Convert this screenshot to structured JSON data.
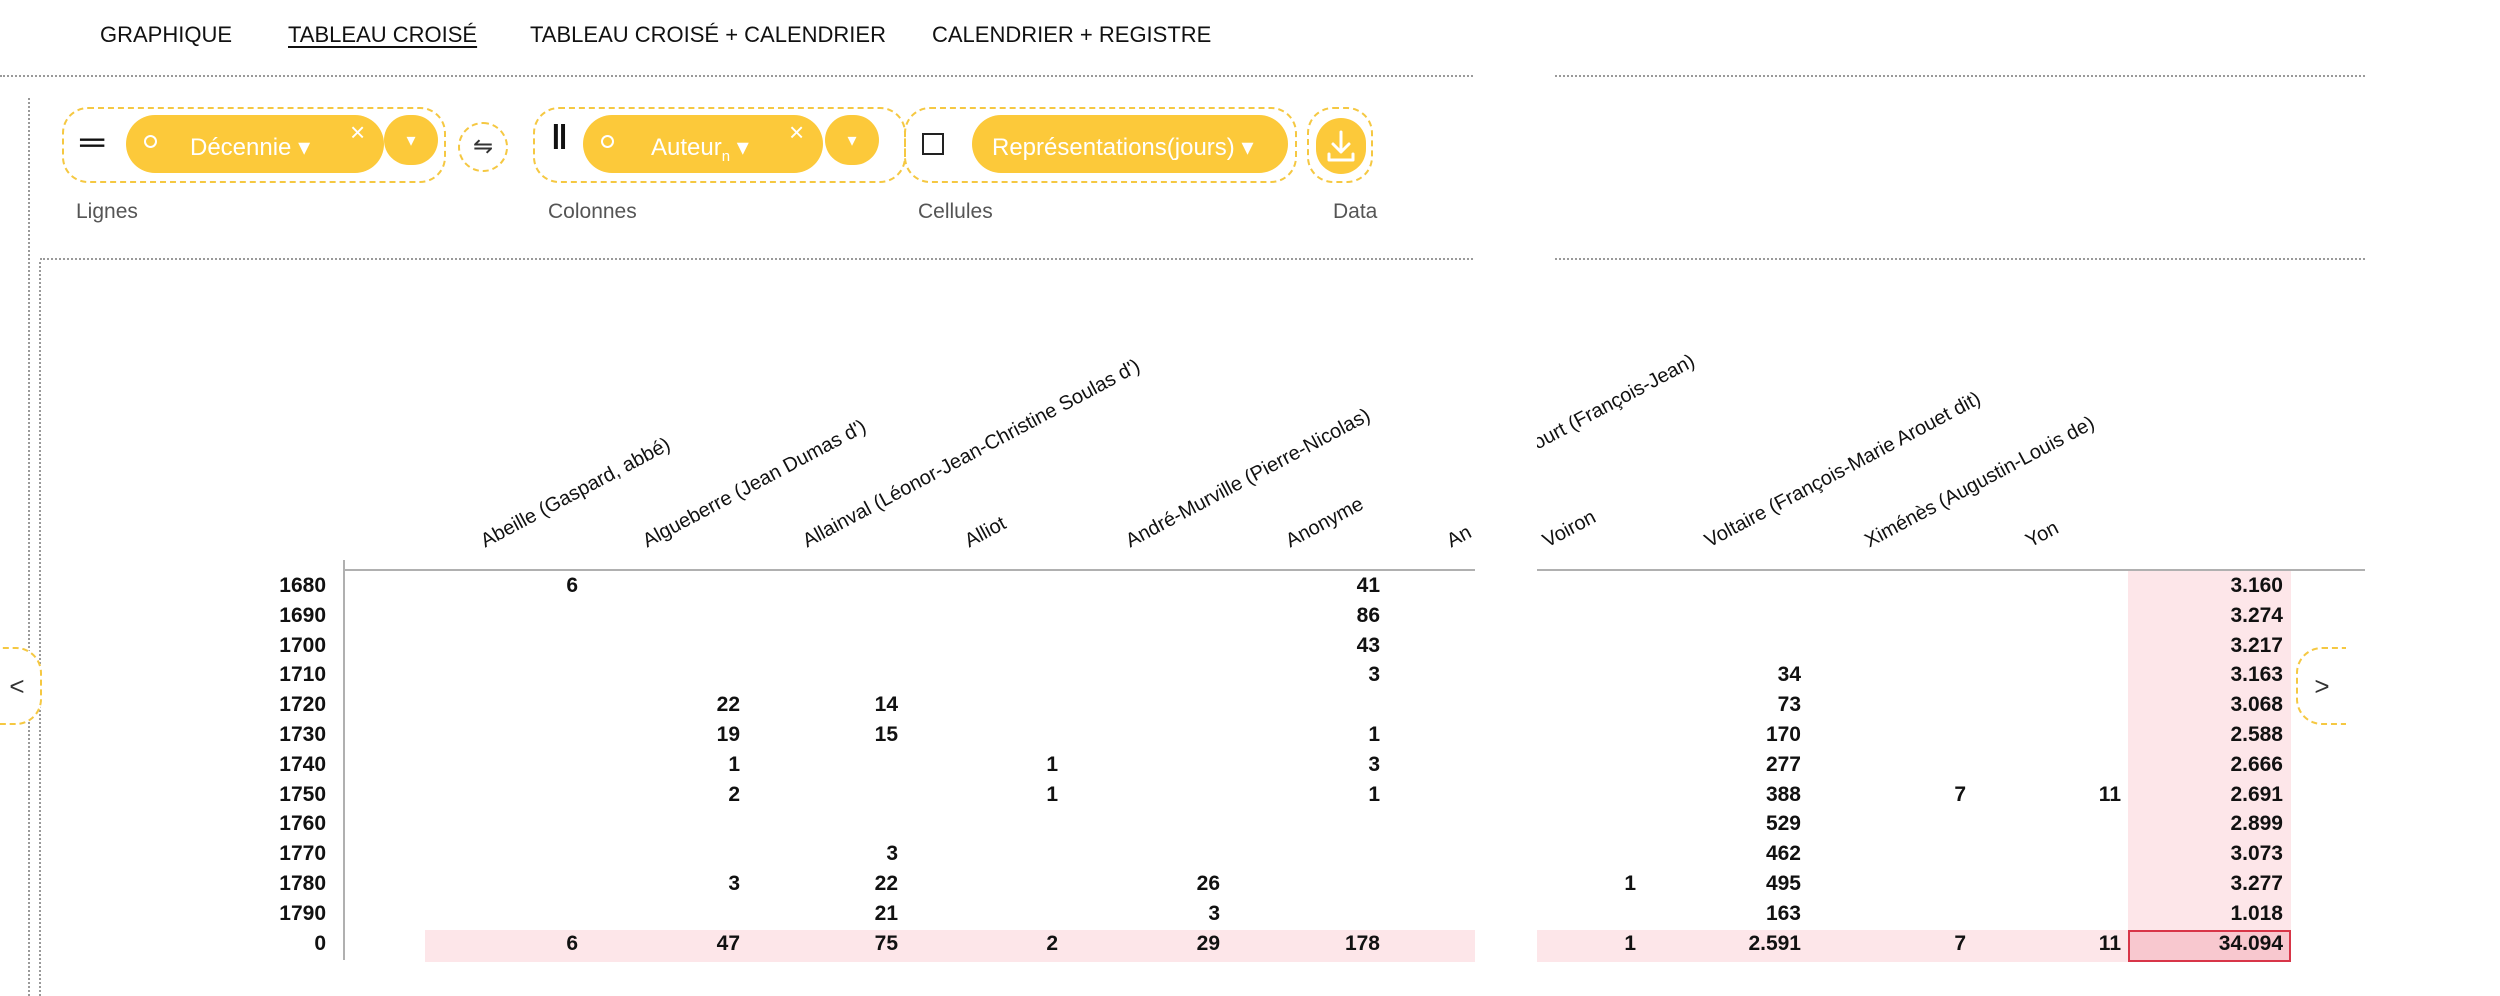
{
  "nav": {
    "items": [
      "GRAPHIQUE",
      "TABLEAU CROISÉ",
      "TABLEAU CROISÉ + CALENDRIER",
      "CALENDRIER + REGISTRE"
    ],
    "active": "TABLEAU CROISÉ"
  },
  "controls": {
    "rows": {
      "label": "Lignes",
      "pill": "Décennie ▾",
      "remove": "×",
      "dropdown": "▾"
    },
    "swap": "⇋",
    "columns": {
      "label": "Colonnes",
      "pill_main": "Auteur",
      "pill_sub": "n",
      "pill_suffix": " ▾",
      "remove": "×",
      "dropdown": "▾"
    },
    "cells": {
      "label": "Cellules",
      "pill": "Représentations(jours) ▾"
    },
    "data": {
      "label": "Data"
    }
  },
  "side_arrows": {
    "left": "<",
    "right": ">"
  },
  "table": {
    "columns": [
      "Abeille (Gaspard, abbé)",
      "Algueberre (Jean Dumas d')",
      "Allainval (Léonor-Jean-Christine Soulas d')",
      "Alliot",
      "André-Murville (Pierre-Nicolas)",
      "Anonyme",
      "An",
      "ourt (François-Jean)",
      "Voiron",
      "Voltaire (François-Marie Arouet dit)",
      "Ximénès (Augustin-Louis de)",
      "Yon"
    ],
    "rows": [
      "1680",
      "1690",
      "1700",
      "1710",
      "1720",
      "1730",
      "1740",
      "1750",
      "1760",
      "1770",
      "1780",
      "1790",
      "0"
    ],
    "cells": [
      [
        "6",
        "",
        "",
        "",
        "",
        "41",
        "",
        "",
        "",
        "",
        "3.160"
      ],
      [
        "",
        "",
        "",
        "",
        "",
        "86",
        "",
        "",
        "",
        "",
        "3.274"
      ],
      [
        "",
        "",
        "",
        "",
        "",
        "43",
        "",
        "",
        "",
        "",
        "3.217"
      ],
      [
        "",
        "",
        "",
        "",
        "",
        "3",
        "",
        "34",
        "",
        "",
        "3.163"
      ],
      [
        "",
        "22",
        "14",
        "",
        "",
        "",
        "",
        "73",
        "",
        "",
        "3.068"
      ],
      [
        "",
        "19",
        "15",
        "",
        "",
        "1",
        "",
        "170",
        "",
        "",
        "2.588"
      ],
      [
        "",
        "1",
        "",
        "1",
        "",
        "3",
        "",
        "277",
        "",
        "",
        "2.666"
      ],
      [
        "",
        "2",
        "",
        "1",
        "",
        "1",
        "",
        "388",
        "7",
        "11",
        "2.691"
      ],
      [
        "",
        "",
        "",
        "",
        "",
        "",
        "",
        "529",
        "",
        "",
        "2.899"
      ],
      [
        "",
        "",
        "3",
        "",
        "",
        "",
        "",
        "462",
        "",
        "",
        "3.073"
      ],
      [
        "",
        "3",
        "22",
        "",
        "26",
        "",
        "1",
        "495",
        "",
        "",
        "3.277"
      ],
      [
        "",
        "",
        "21",
        "",
        "3",
        "",
        "",
        "163",
        "",
        "",
        "1.018"
      ],
      [
        "6",
        "47",
        "75",
        "2",
        "29",
        "178",
        "1",
        "2.591",
        "7",
        "11",
        "34.094"
      ]
    ]
  },
  "colors": {
    "accent": "#fcc93a",
    "accent_border": "#f5c842",
    "total_fill": "#fde6e9",
    "grand_fill": "#f8c8cf",
    "grand_border": "#d83548"
  }
}
